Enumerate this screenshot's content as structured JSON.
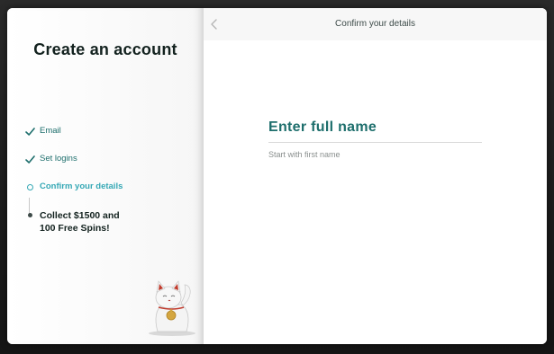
{
  "sidebar": {
    "title": "Create an account",
    "steps": [
      {
        "label": "Email",
        "state": "done"
      },
      {
        "label": "Set logins",
        "state": "done"
      },
      {
        "label": "Confirm your details",
        "state": "current"
      },
      {
        "label": "Collect $1500 and\n100 Free Spins!",
        "state": "upcoming"
      }
    ],
    "mascot_icon": "lucky-cat-icon"
  },
  "header": {
    "title": "Confirm your details",
    "back_icon": "chevron-left-icon"
  },
  "form": {
    "field_label": "Enter full name",
    "field_value": "",
    "hint": "Start with first name"
  },
  "colors": {
    "accent_teal": "#1d6e6c",
    "current_step": "#35a8b5",
    "heading": "#13221f"
  }
}
